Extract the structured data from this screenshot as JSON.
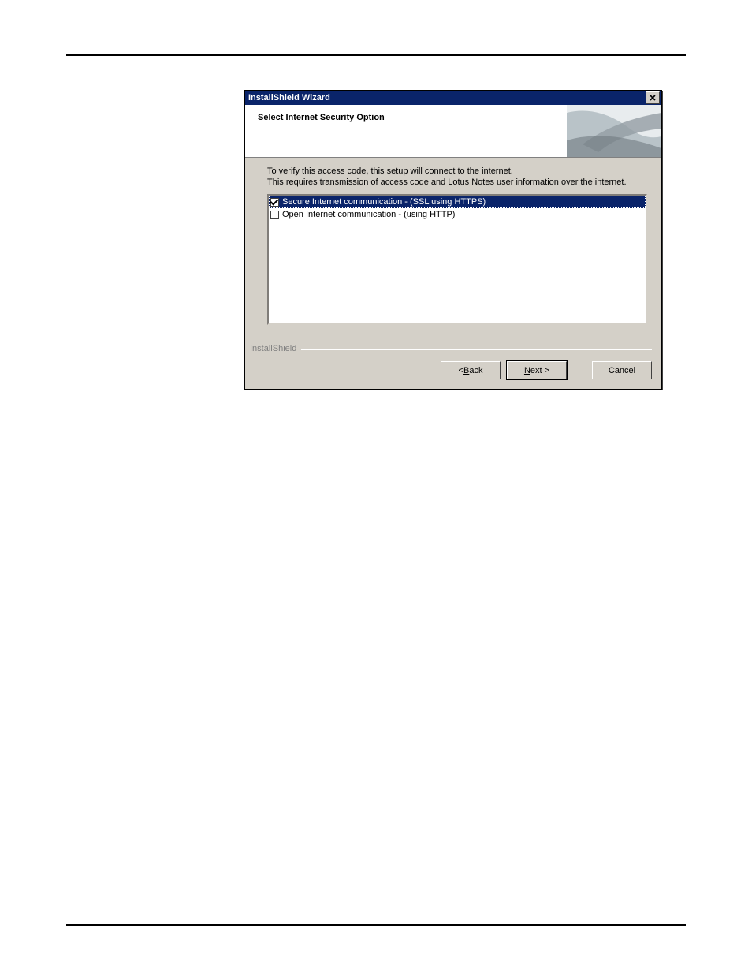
{
  "dialog": {
    "title": "InstallShield Wizard",
    "close_icon": "x",
    "header_title": "Select Internet Security Option",
    "body_line1": "To verify this access code, this setup will connect to the internet.",
    "body_line2": "This requires transmission of access code and Lotus Notes user information over the internet.",
    "options": [
      {
        "label": "Secure Internet communication - (SSL using HTTPS)",
        "checked": true,
        "selected": true
      },
      {
        "label": "Open Internet communication - (using HTTP)",
        "checked": false,
        "selected": false
      }
    ],
    "brand": "InstallShield",
    "buttons": {
      "back_prefix": "< ",
      "back_mn": "B",
      "back_suffix": "ack",
      "next_mn": "N",
      "next_suffix": "ext >",
      "cancel": "Cancel"
    }
  }
}
